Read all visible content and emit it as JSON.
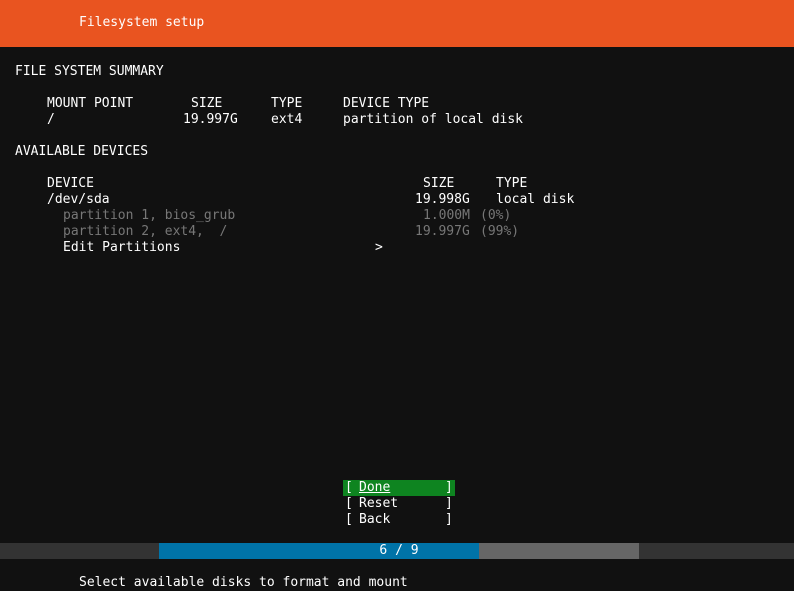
{
  "header": {
    "title": "Filesystem setup",
    "background": "#e95420"
  },
  "summary": {
    "heading": "FILE SYSTEM SUMMARY",
    "columns": {
      "mount_point": "MOUNT POINT",
      "size": "SIZE",
      "type": "TYPE",
      "device_type": "DEVICE TYPE"
    },
    "rows": [
      {
        "mount_point": "/",
        "size": "19.997G",
        "type": "ext4",
        "device_type": "partition of local disk"
      }
    ]
  },
  "devices": {
    "heading": "AVAILABLE DEVICES",
    "columns": {
      "device": "DEVICE",
      "size": "SIZE",
      "type": "TYPE"
    },
    "disk": {
      "name": "/dev/sda",
      "size": "19.998G",
      "type": "local disk"
    },
    "partitions": [
      {
        "label": "partition 1, bios_grub",
        "size": "1.000M",
        "pct": "(0%)"
      },
      {
        "label": "partition 2, ext4,  /",
        "size": "19.997G",
        "pct": "(99%)"
      }
    ],
    "action": {
      "label": "Edit Partitions",
      "chevron": ">"
    }
  },
  "buttons": {
    "bracket_open": "[",
    "bracket_close": "]",
    "done": "Done",
    "reset": "Reset",
    "back": "Back",
    "focused": "done",
    "focus_color": "#0e8420"
  },
  "progress": {
    "text": "6 / 9",
    "current": 6,
    "total": 9,
    "fill_color": "#0073a8",
    "track_color": "#666666"
  },
  "help": {
    "text": "Select available disks to format and mount"
  }
}
